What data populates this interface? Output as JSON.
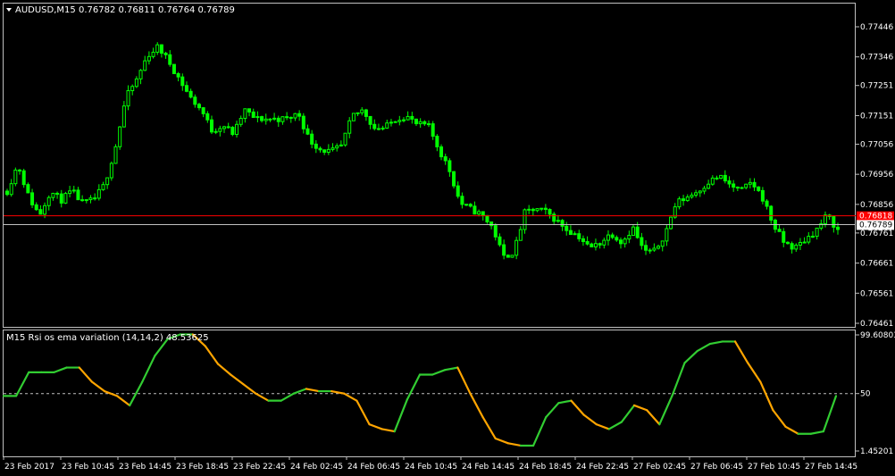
{
  "chart_data": [
    {
      "type": "candlestick",
      "title": "AUDUSD,M15",
      "ohlc_readout": "0.76782 0.76811 0.76764 0.76789",
      "colors": {
        "candle": "#00ff00",
        "background": "#000000",
        "ask_line": "#ff0000",
        "bid_line": "#c0c0c0"
      },
      "ylim": [
        0.76461,
        0.77446
      ],
      "y_ticks": [
        "0.77446",
        "0.77346",
        "0.77251",
        "0.77151",
        "0.77056",
        "0.76956",
        "0.76856",
        "0.76761",
        "0.76661",
        "0.76561",
        "0.76461"
      ],
      "ask_price": "0.76818",
      "bid_price": "0.76789",
      "closes_approx": [
        0.769,
        0.7699,
        0.7688,
        0.7682,
        0.769,
        0.7687,
        0.769,
        0.7686,
        0.7687,
        0.7692,
        0.7704,
        0.7721,
        0.7727,
        0.7735,
        0.7738,
        0.7733,
        0.7727,
        0.7721,
        0.7717,
        0.771,
        0.7712,
        0.7709,
        0.7717,
        0.7714,
        0.7714,
        0.7714,
        0.7714,
        0.7716,
        0.7707,
        0.7704,
        0.7703,
        0.7705,
        0.7715,
        0.7717,
        0.7711,
        0.7711,
        0.7714,
        0.7715,
        0.7712,
        0.7712,
        0.7704,
        0.7697,
        0.7686,
        0.7684,
        0.7682,
        0.7678,
        0.7668,
        0.767,
        0.7683,
        0.7684,
        0.7683,
        0.768,
        0.7677,
        0.7675,
        0.7671,
        0.7673,
        0.7676,
        0.7673,
        0.7678,
        0.767,
        0.767,
        0.7676,
        0.7686,
        0.7688,
        0.769,
        0.7693,
        0.7695,
        0.7692,
        0.769,
        0.7693,
        0.7688,
        0.7679,
        0.7673,
        0.7671,
        0.7674,
        0.7677,
        0.7682,
        0.7677
      ]
    },
    {
      "type": "line",
      "title": "M15 Rsi os ema variation (14,14,2) 48.53625",
      "ylim": [
        1.452,
        99.608
      ],
      "y_ticks": [
        "99.60803",
        "50",
        "1.45201"
      ],
      "level": 50,
      "colors": {
        "rising": "#32cd32",
        "falling": "#ffa500",
        "level_line": "#c0c0c0"
      },
      "values_approx": [
        48,
        48,
        68,
        68,
        68,
        72,
        72,
        60,
        52,
        48,
        40,
        60,
        82,
        96,
        100,
        100,
        90,
        75,
        66,
        58,
        50,
        44,
        44,
        50,
        54,
        52,
        52,
        50,
        44,
        24,
        20,
        18,
        45,
        66,
        66,
        70,
        72,
        50,
        30,
        12,
        8,
        6,
        6,
        30,
        42,
        44,
        32,
        24,
        20,
        26,
        40,
        36,
        24,
        48,
        76,
        86,
        92,
        94,
        94,
        76,
        60,
        36,
        22,
        16,
        16,
        18,
        48
      ]
    }
  ],
  "x_axis": {
    "tick_labels": [
      "23 Feb 2017",
      "23 Feb 10:45",
      "23 Feb 14:45",
      "23 Feb 18:45",
      "23 Feb 22:45",
      "24 Feb 02:45",
      "24 Feb 06:45",
      "24 Feb 10:45",
      "24 Feb 14:45",
      "24 Feb 18:45",
      "24 Feb 22:45",
      "27 Feb 02:45",
      "27 Feb 06:45",
      "27 Feb 10:45",
      "27 Feb 14:45"
    ]
  }
}
